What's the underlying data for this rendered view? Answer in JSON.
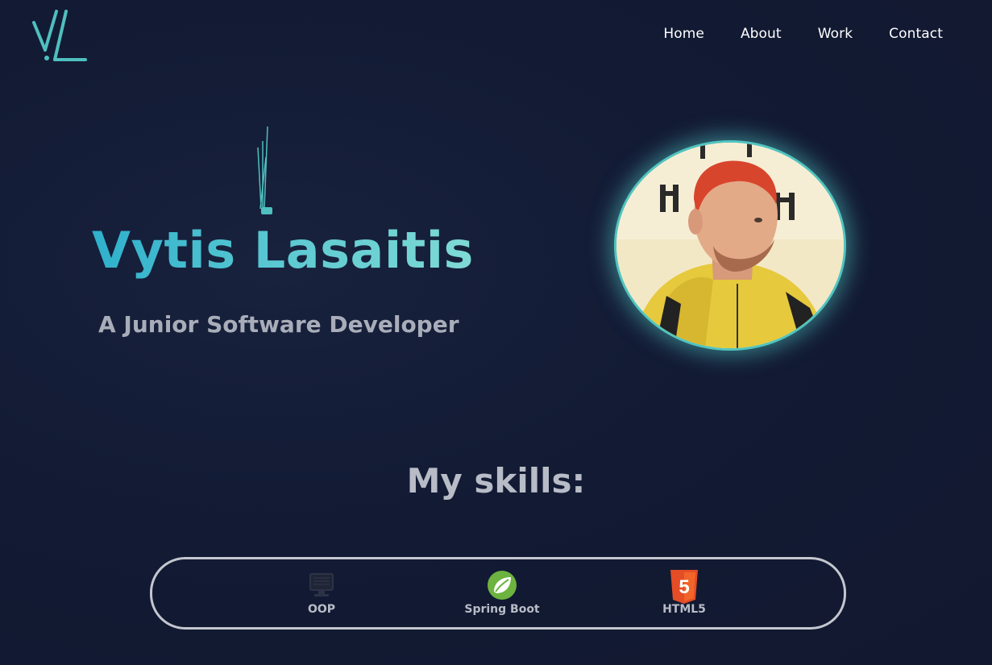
{
  "header": {
    "logo_alt": "VL",
    "nav": [
      {
        "label": "Home"
      },
      {
        "label": "About"
      },
      {
        "label": "Work"
      },
      {
        "label": "Contact"
      }
    ]
  },
  "hero": {
    "name": "Vytis Lasaitis",
    "subtitle": "A Junior Software Developer"
  },
  "skills": {
    "title": "My skills:",
    "items": [
      {
        "label": "OOP",
        "icon": "monitor-icon"
      },
      {
        "label": "Spring Boot",
        "icon": "spring-leaf-icon"
      },
      {
        "label": "HTML5",
        "icon": "html5-icon"
      }
    ]
  },
  "colors": {
    "accent": "#51c4c0",
    "background": "#121a33",
    "text_muted": "#a9adb9",
    "spring_green": "#6db33f",
    "html5_orange": "#e44d26"
  }
}
